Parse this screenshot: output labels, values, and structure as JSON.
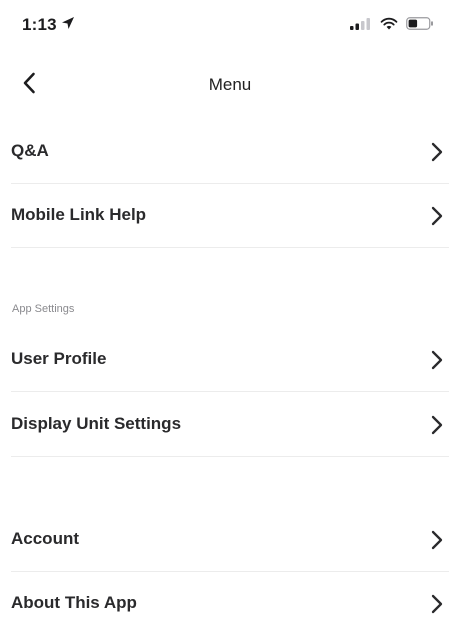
{
  "status_bar": {
    "time": "1:13"
  },
  "nav": {
    "title": "Menu"
  },
  "menu": {
    "items": [
      {
        "label": "Q&A"
      },
      {
        "label": "Mobile Link Help"
      }
    ]
  },
  "app_settings": {
    "header": "App Settings",
    "items": [
      {
        "label": "User Profile"
      },
      {
        "label": "Display Unit Settings"
      }
    ]
  },
  "account_section": {
    "items": [
      {
        "label": "Account"
      },
      {
        "label": "About This App"
      }
    ]
  },
  "icons": {
    "back": "chevron-left-icon",
    "row_chevron": "chevron-right-icon",
    "location": "location-arrow-icon",
    "signal": "cellular-signal-icon",
    "wifi": "wifi-icon",
    "battery": "battery-icon"
  }
}
